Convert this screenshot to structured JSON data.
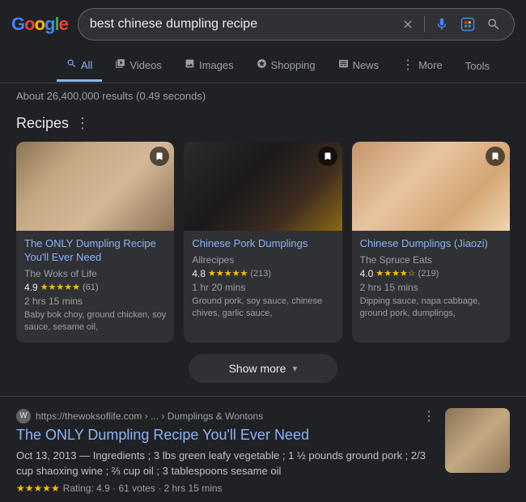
{
  "header": {
    "logo": {
      "g": "G",
      "o1": "o",
      "o2": "o",
      "gl": "g",
      "e": "l",
      "e2": "e"
    },
    "search_query": "best chinese dumpling recipe",
    "clear_icon": "✕",
    "mic_icon": "🎤",
    "lens_icon": "⬡",
    "search_icon": "🔍"
  },
  "nav": {
    "tabs": [
      {
        "id": "all",
        "label": "All",
        "icon": "🔍",
        "active": true
      },
      {
        "id": "videos",
        "label": "Videos",
        "icon": "▶"
      },
      {
        "id": "images",
        "label": "Images",
        "icon": "🖼"
      },
      {
        "id": "shopping",
        "label": "Shopping",
        "icon": "🛍"
      },
      {
        "id": "news",
        "label": "News",
        "icon": "📰"
      },
      {
        "id": "more",
        "label": "More",
        "icon": "⋮"
      }
    ],
    "tools_label": "Tools"
  },
  "results_info": {
    "text": "About 26,400,000 results (0.49 seconds)"
  },
  "recipes": {
    "title": "Recipes",
    "cards": [
      {
        "id": "card1",
        "title": "The ONLY Dumpling Recipe You'll Ever Need",
        "source": "The Woks of Life",
        "rating": "4.9",
        "stars": "★★★★★",
        "count": "(61)",
        "time": "2 hrs 15 mins",
        "ingredients": "Baby bok choy, ground chicken, soy sauce, sesame oil,",
        "img_emoji": "🥟"
      },
      {
        "id": "card2",
        "title": "Chinese Pork Dumplings",
        "source": "Allrecipes",
        "rating": "4.8",
        "stars": "★★★★★",
        "count": "(213)",
        "time": "1 hr 20 mins",
        "ingredients": "Ground pork, soy sauce, chinese chives, garlic sauce,",
        "img_emoji": "🥟"
      },
      {
        "id": "card3",
        "title": "Chinese Dumplings (Jiaozi)",
        "source": "The Spruce Eats",
        "rating": "4.0",
        "stars": "★★★★☆",
        "count": "(219)",
        "time": "2 hrs 15 mins",
        "ingredients": "Dipping sauce, napa cabbage, ground pork, dumplings,",
        "img_emoji": "🥟"
      }
    ],
    "show_more_label": "Show more"
  },
  "organic": {
    "site_icon": "W",
    "url_prefix": "https://thewoksoflife.com",
    "url_middle": "› ... ›",
    "url_section": "Dumplings & Wontons",
    "title": "The ONLY Dumpling Recipe You'll Ever Need",
    "date": "Oct 13, 2013",
    "snippet_bold": "Ingredients",
    "snippet": " ; 3 lbs green leafy vegetable ; 1 ½ pounds ground pork ; 2/3 cup shaoxing wine ; ⅔ cup oil ; 3 tablespoons sesame oil",
    "rating_stars": "★★★★★",
    "rating_text": "Rating: 4.9 · 61 votes · 2 hrs 15 mins",
    "thumb_emoji": "🥟"
  }
}
